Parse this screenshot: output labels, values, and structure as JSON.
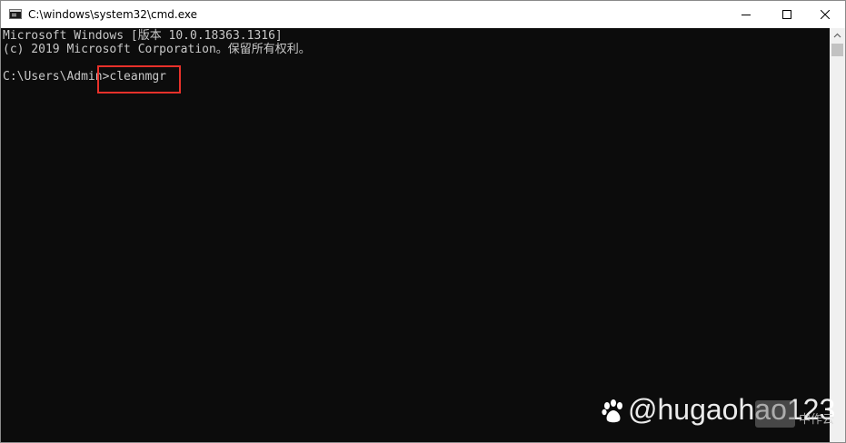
{
  "window": {
    "title": "C:\\windows\\system32\\cmd.exe",
    "icon": "console-app-icon",
    "controls": [
      "minimize-icon",
      "maximize-icon",
      "close-icon"
    ]
  },
  "console": {
    "lines": [
      "Microsoft Windows [版本 10.0.18363.1316]",
      "(c) 2019 Microsoft Corporation。保留所有权利。",
      "C:\\Users\\Admin>cleanmgr"
    ],
    "highlight_color": "#e8312a",
    "background_color": "#0c0c0c",
    "text_color": "#c8c8c8"
  },
  "watermark": {
    "handle": "@hugaohao123",
    "logo": "baidu-paw-icon",
    "badge_label": "中作云"
  }
}
